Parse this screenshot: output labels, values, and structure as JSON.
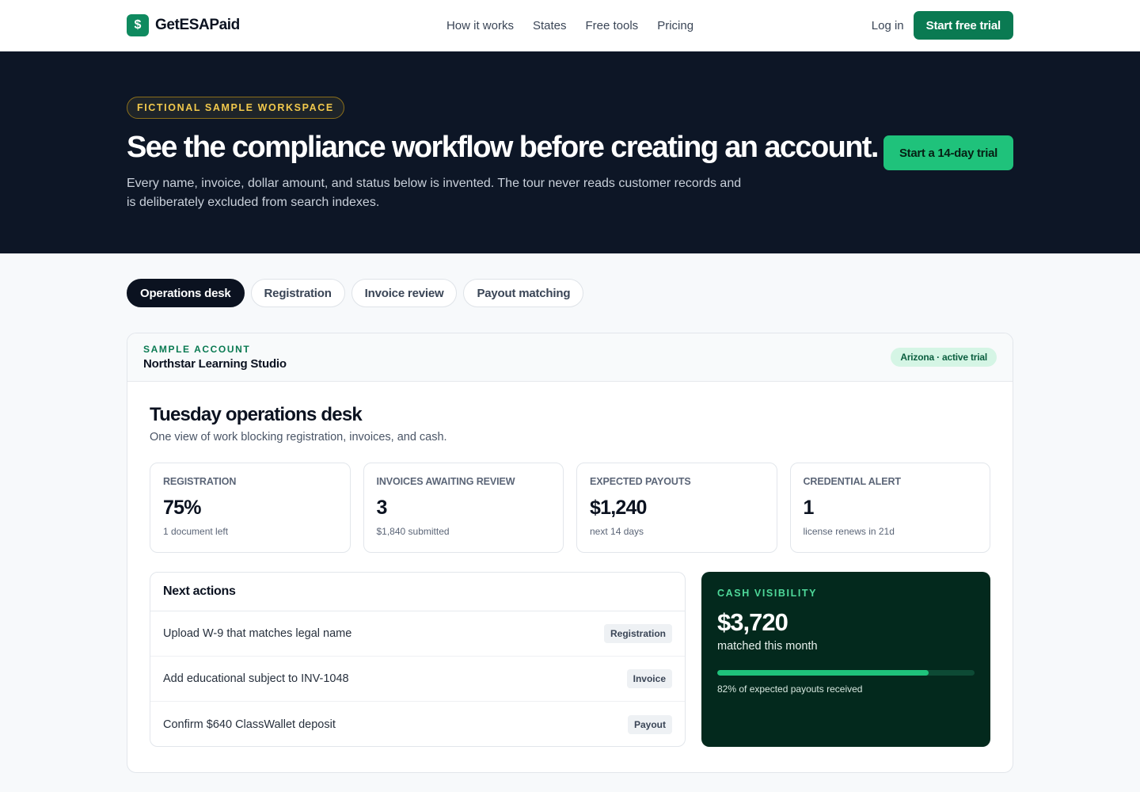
{
  "nav": {
    "brand_mark": "$",
    "brand_name": "GetESAPaid",
    "links": [
      "How it works",
      "States",
      "Free tools",
      "Pricing"
    ],
    "login": "Log in",
    "cta": "Start free trial"
  },
  "hero": {
    "badge": "FICTIONAL SAMPLE WORKSPACE",
    "title": "See the compliance workflow before creating an account.",
    "subtitle": "Every name, invoice, dollar amount, and status below is invented. The tour never reads customer records and is deliberately excluded from search indexes.",
    "cta": "Start a 14-day trial"
  },
  "tabs": [
    {
      "label": "Operations desk",
      "active": true
    },
    {
      "label": "Registration",
      "active": false
    },
    {
      "label": "Invoice review",
      "active": false
    },
    {
      "label": "Payout matching",
      "active": false
    }
  ],
  "account": {
    "eyebrow": "SAMPLE ACCOUNT",
    "name": "Northstar Learning Studio",
    "status": "Arizona · active trial"
  },
  "desk": {
    "title": "Tuesday operations desk",
    "subtitle": "One view of work blocking registration, invoices, and cash."
  },
  "stats": [
    {
      "label": "REGISTRATION",
      "value": "75%",
      "note": "1 document left"
    },
    {
      "label": "INVOICES AWAITING REVIEW",
      "value": "3",
      "note": "$1,840 submitted"
    },
    {
      "label": "EXPECTED PAYOUTS",
      "value": "$1,240",
      "note": "next 14 days"
    },
    {
      "label": "CREDENTIAL ALERT",
      "value": "1",
      "note": "license renews in 21d"
    }
  ],
  "actions": {
    "title": "Next actions",
    "items": [
      {
        "text": "Upload W-9 that matches legal name",
        "tag": "Registration"
      },
      {
        "text": "Add educational subject to INV-1048",
        "tag": "Invoice"
      },
      {
        "text": "Confirm $640 ClassWallet deposit",
        "tag": "Payout"
      }
    ]
  },
  "cash": {
    "eyebrow": "CASH VISIBILITY",
    "value": "$3,720",
    "subtitle": "matched this month",
    "progress_percent": 82,
    "note": "82% of expected payouts received"
  },
  "colors": {
    "brand": "#0a7a52",
    "hero_bg": "#0d1626",
    "accent_green": "#1fc27b",
    "badge_gold": "#f2c94c",
    "cash_bg": "#03291d"
  }
}
